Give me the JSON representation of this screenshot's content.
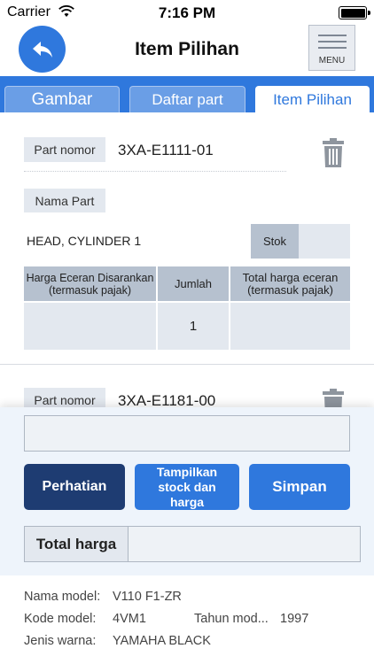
{
  "status_bar": {
    "carrier": "Carrier",
    "time": "7:16 PM"
  },
  "header": {
    "title": "Item Pilihan",
    "menu_label": "MENU"
  },
  "tabs": [
    {
      "label": "Gambar"
    },
    {
      "label": "Daftar part"
    },
    {
      "label": "Item Pilihan",
      "active": true
    }
  ],
  "item": {
    "part_no_label": "Part nomor",
    "part_no": "3XA-E1111-01",
    "name_label": "Nama Part",
    "name": "HEAD, CYLINDER 1",
    "stock_label": "Stok",
    "stock_value": "",
    "table": {
      "headers": [
        "Harga Eceran Disarankan (termasuk pajak)",
        "Jumlah",
        "Total harga eceran (termasuk pajak)"
      ],
      "row": [
        "",
        "1",
        ""
      ]
    }
  },
  "item2": {
    "part_no_label": "Part nomor",
    "part_no": "3XA-E1181-00"
  },
  "panel": {
    "input_value": "",
    "btn_perhatian": "Perhatian",
    "btn_stock": "Tampilkan stock dan harga",
    "btn_simpan": "Simpan",
    "total_label": "Total harga",
    "total_value": ""
  },
  "footer": {
    "model_name_label": "Nama model:",
    "model_name": "V110 F1-ZR",
    "model_code_label": "Kode model:",
    "model_code": "4VM1",
    "year_label": "Tahun mod...",
    "year": "1997",
    "color_label": "Jenis warna:",
    "color": "YAMAHA BLACK"
  },
  "colors": {
    "primary": "#2f78dd",
    "dark_button": "#1e3c72",
    "chip": "#e3e8ef",
    "table_header": "#b6c1cf"
  }
}
